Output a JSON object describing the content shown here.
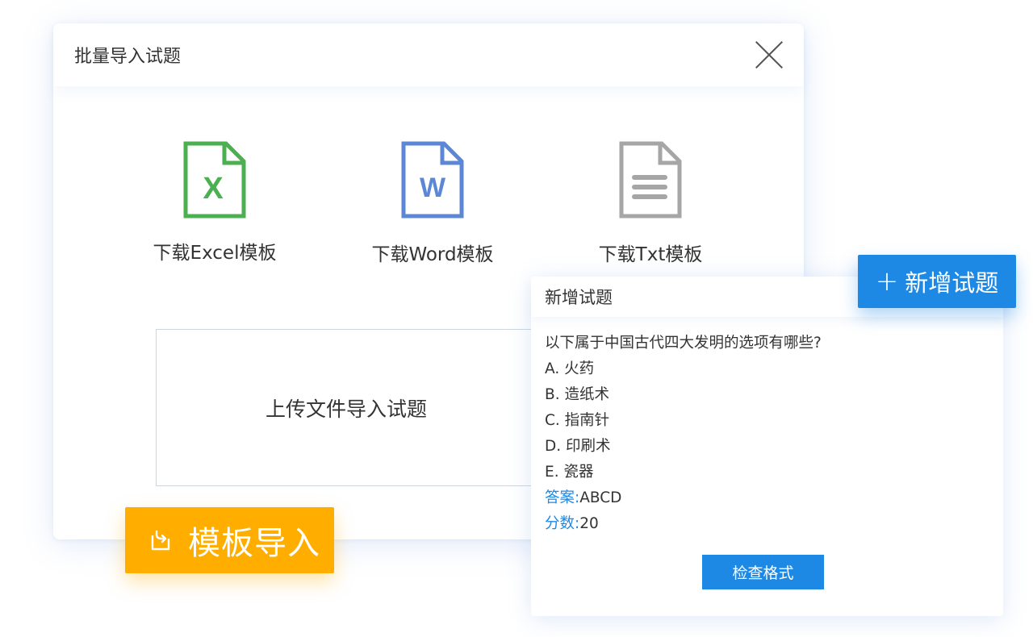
{
  "import_dialog": {
    "title": "批量导入试题",
    "templates": [
      {
        "label": "下载Excel模板",
        "icon": "excel-file-icon",
        "color": "#4caf50",
        "glyph": "X"
      },
      {
        "label": "下载Word模板",
        "icon": "word-file-icon",
        "color": "#5b87d6",
        "glyph": "W"
      },
      {
        "label": "下载Txt模板",
        "icon": "txt-file-icon",
        "color": "#a6a6a6"
      }
    ],
    "upload_label": "上传文件导入试题"
  },
  "template_import_badge": {
    "label": "模板导入",
    "icon": "import-icon",
    "color": "#ffae00"
  },
  "new_question_panel": {
    "title": "新增试题",
    "question": "以下属于中国古代四大发明的选项有哪些?",
    "options": [
      "A. 火药",
      "B. 造纸术",
      "C. 指南针",
      "D. 印刷术",
      "E. 瓷器"
    ],
    "answer_label": "答案:",
    "answer_value": "ABCD",
    "score_label": "分数:",
    "score_value": "20",
    "check_button": "检查格式"
  },
  "add_question_badge": {
    "label": "新增试题",
    "icon": "plus-icon",
    "color": "#1e88e5"
  }
}
